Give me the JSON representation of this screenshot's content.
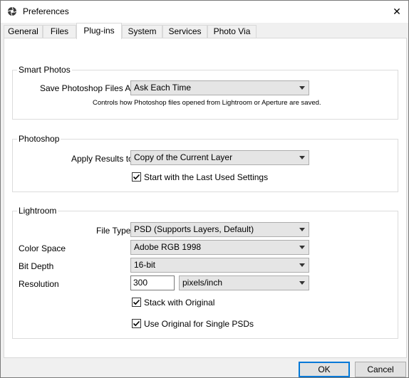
{
  "window": {
    "title": "Preferences",
    "icon": "camera-shutter-icon",
    "close_symbol": "✕"
  },
  "tabs": [
    {
      "label": "General"
    },
    {
      "label": "Files"
    },
    {
      "label": "Plug-ins",
      "active": true
    },
    {
      "label": "System"
    },
    {
      "label": "Services"
    },
    {
      "label": "Photo Via"
    }
  ],
  "smart_photos": {
    "title": "Smart Photos",
    "save_label": "Save Photoshop Files As:",
    "save_value": "Ask Each Time",
    "description": "Controls how Photoshop files opened from Lightroom or Aperture are saved."
  },
  "photoshop": {
    "title": "Photoshop",
    "apply_label": "Apply Results to",
    "apply_value": "Copy of the Current Layer",
    "last_used_label": "Start with the Last Used Settings",
    "last_used_checked": true
  },
  "lightroom": {
    "title": "Lightroom",
    "file_type_label": "File Type",
    "file_type_value": "PSD (Supports Layers, Default)",
    "color_space_label": "Color Space",
    "color_space_value": "Adobe RGB 1998",
    "bit_depth_label": "Bit Depth",
    "bit_depth_value": "16-bit",
    "resolution_label": "Resolution",
    "resolution_value": "300",
    "resolution_unit": "pixels/inch",
    "stack_label": "Stack with Original",
    "stack_checked": true,
    "single_psd_label": "Use Original for Single PSDs",
    "single_psd_checked": true
  },
  "buttons": {
    "ok": "OK",
    "cancel": "Cancel"
  },
  "colors": {
    "accent": "#0078d7",
    "panel": "#f0f0f0",
    "content": "#ffffff"
  }
}
